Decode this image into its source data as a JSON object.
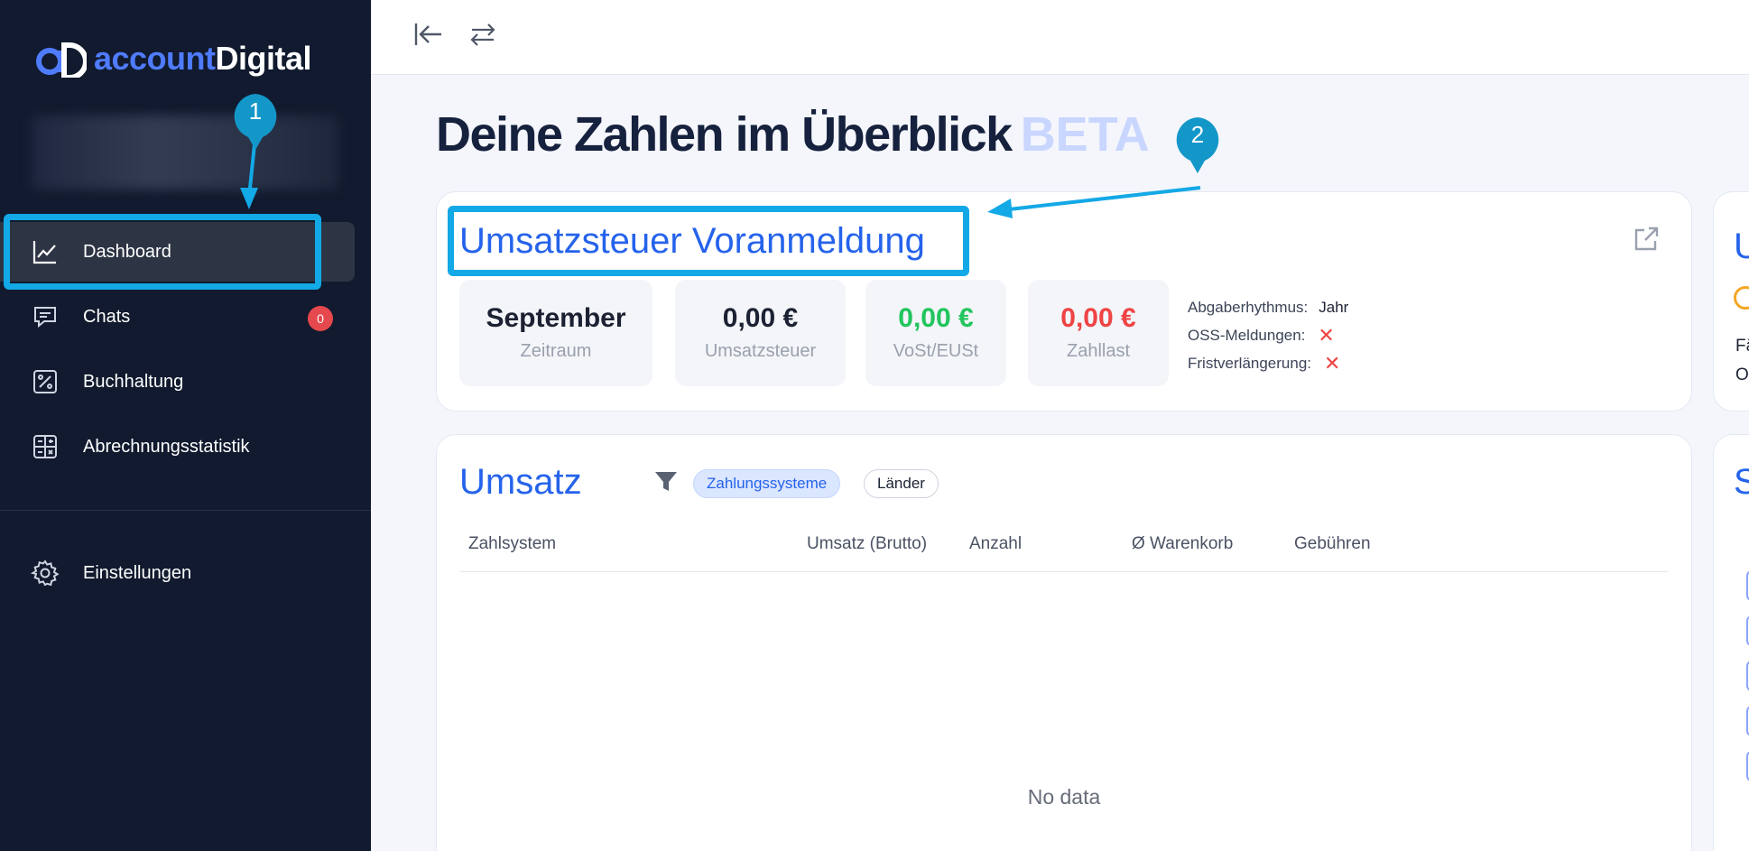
{
  "app": {
    "logo_part1": "account",
    "logo_part2": "Digital"
  },
  "sidebar": {
    "items": [
      {
        "label": "Dashboard",
        "icon": "line-chart-icon"
      },
      {
        "label": "Chats",
        "icon": "chat-icon",
        "badge": "0"
      },
      {
        "label": "Buchhaltung",
        "icon": "percent-icon"
      },
      {
        "label": "Abrechnungsstatistik",
        "icon": "calculator-icon"
      },
      {
        "label": "Einstellungen",
        "icon": "gear-icon"
      }
    ]
  },
  "topbar": {
    "icons": [
      "collapse-sidebar-icon",
      "switch-icon"
    ]
  },
  "annotations": [
    "1",
    "2"
  ],
  "page": {
    "title": "Deine Zahlen im Überblick",
    "badge": "BETA"
  },
  "vat_card": {
    "title": "Umsatzsteuer Voranmeldung",
    "stats": [
      {
        "value": "September",
        "label": "Zeitraum"
      },
      {
        "value": "0,00 €",
        "label": "Umsatzsteuer"
      },
      {
        "value": "0,00 €",
        "label": "VoSt/EUSt"
      },
      {
        "value": "0,00 €",
        "label": "Zahllast"
      }
    ],
    "meta": [
      {
        "key": "Abgaberhythmus:",
        "value": "Jahr"
      },
      {
        "key": "OSS-Meldungen:",
        "value": "✕"
      },
      {
        "key": "Fristverlängerung:",
        "value": "✕"
      }
    ]
  },
  "revenue_card": {
    "title": "Umsatz",
    "chips": [
      "Zahlungssysteme",
      "Länder"
    ],
    "columns": [
      "Zahlsystem",
      "Umsatz (Brutto)",
      "Anzahl",
      "Ø Warenkorb",
      "Gebühren"
    ],
    "empty_text": "No data"
  },
  "right_fragments": {
    "top_letters": [
      "U",
      "Fä",
      "O"
    ],
    "bottom_letter": "S"
  },
  "colors": {
    "sidebar_bg": "#111a2e",
    "accent": "#2563eb",
    "highlight": "#13a8e6",
    "positive": "#22c55e",
    "negative": "#ef4444"
  }
}
